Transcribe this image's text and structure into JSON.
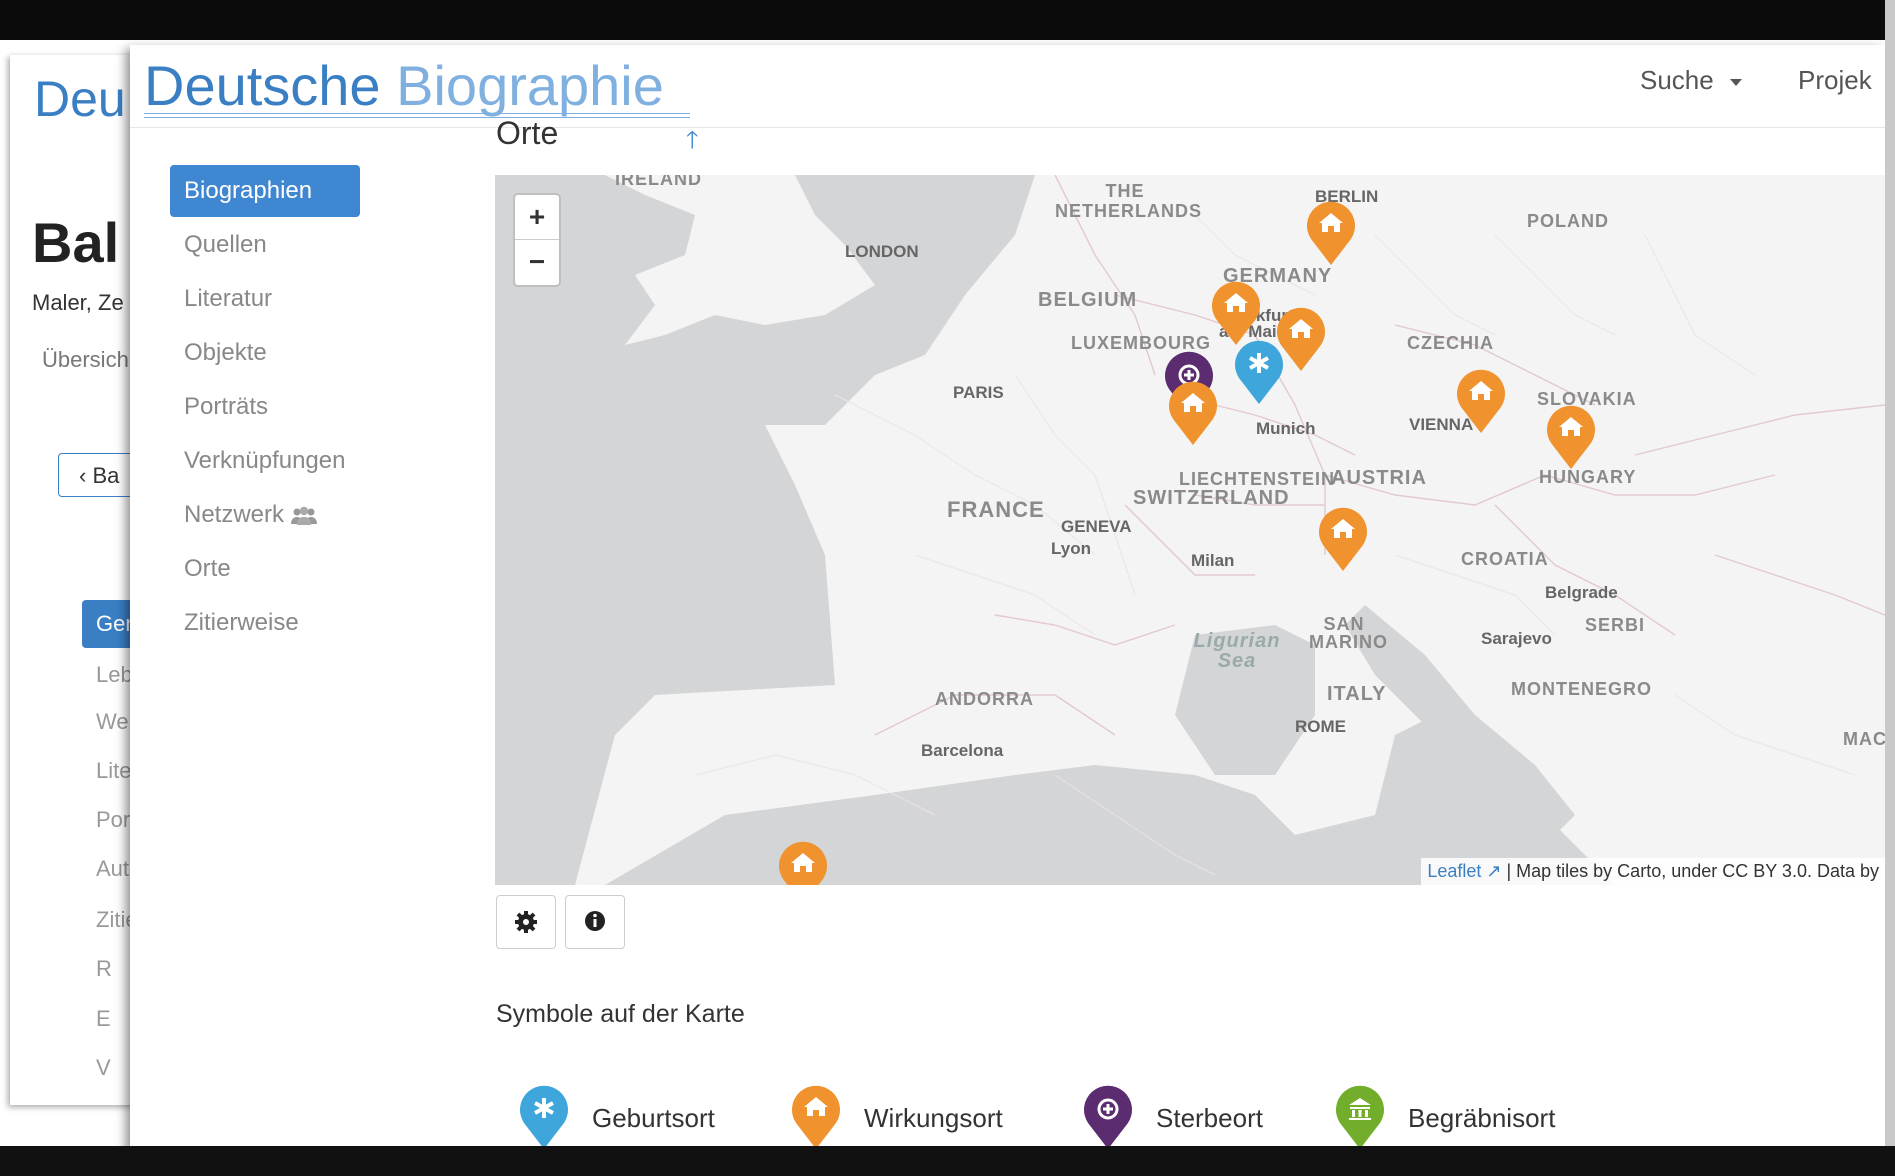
{
  "background_window": {
    "logo": "Deu",
    "title": "Bal",
    "subtitle": "Maler, Ze",
    "overview": "Übersich",
    "back_button": "Ba",
    "active_item": "Gen",
    "items": [
      "Leb",
      "Wer",
      "Lite",
      "Port",
      "Aut",
      "Zitie",
      "R",
      "E",
      "V"
    ]
  },
  "header": {
    "logo_part1": "Deutsche",
    "logo_part2": "Biographie",
    "nav_search": "Suche",
    "nav_project": "Projek"
  },
  "sidebar": {
    "items": [
      {
        "label": "Biographien",
        "active": true
      },
      {
        "label": "Quellen"
      },
      {
        "label": "Literatur"
      },
      {
        "label": "Objekte"
      },
      {
        "label": "Porträts"
      },
      {
        "label": "Verknüpfungen"
      },
      {
        "label": "Netzwerk"
      },
      {
        "label": "Orte"
      },
      {
        "label": "Zitierweise"
      }
    ]
  },
  "section": {
    "title": "Orte"
  },
  "map": {
    "zoom_in": "+",
    "zoom_out": "−",
    "attribution_link": "Leaflet",
    "attribution_text": " | Map tiles by Carto, under CC BY 3.0. Data by",
    "labels": {
      "ireland": "IRELAND",
      "netherlands": "THE NETHERLANDS",
      "berlin": "BERLIN",
      "poland": "POLAND",
      "london": "LONDON",
      "germany": "GERMANY",
      "belgium": "BELGIUM",
      "frankfurt": "Frankfurt am Main",
      "luxembourg": "LUXEMBOURG",
      "czechia": "CZECHIA",
      "paris": "PARIS",
      "slovakia": "SLOVAKIA",
      "vienna": "VIENNA",
      "munich": "Munich",
      "hungary": "HUNGARY",
      "liechtenstein": "LIECHTENSTEIN",
      "austria": "AUSTRIA",
      "switzerland": "SWITZERLAND",
      "france": "FRANCE",
      "geneva": "GENEVA",
      "lyon": "Lyon",
      "milan": "Milan",
      "croatia": "CROATIA",
      "belgrade": "Belgrade",
      "serbia": "SERBI",
      "ligurian": "Ligurian Sea",
      "san_marino": "SAN MARINO",
      "sarajevo": "Sarajevo",
      "montenegro": "MONTENEGRO",
      "andorra": "ANDORRA",
      "italy": "ITALY",
      "rome": "ROME",
      "barcelona": "Barcelona",
      "mac": "MAC"
    }
  },
  "legend": {
    "title": "Symbole auf der Karte",
    "items": [
      {
        "label": "Geburtsort",
        "color": "#3fa6dc",
        "icon": "asterisk-icon"
      },
      {
        "label": "Wirkungsort",
        "color": "#f0922e",
        "icon": "home-icon"
      },
      {
        "label": "Sterbeort",
        "color": "#5b2c6f",
        "icon": "plus-circle-icon"
      },
      {
        "label": "Begräbnisort",
        "color": "#72ad2b",
        "icon": "bank-icon"
      }
    ]
  },
  "colors": {
    "brand": "#3a7fc4",
    "active_nav": "#3f87d0",
    "marker_birth": "#3fa6dc",
    "marker_work": "#f0922e",
    "marker_death": "#5b2c6f",
    "marker_burial": "#72ad2b"
  }
}
